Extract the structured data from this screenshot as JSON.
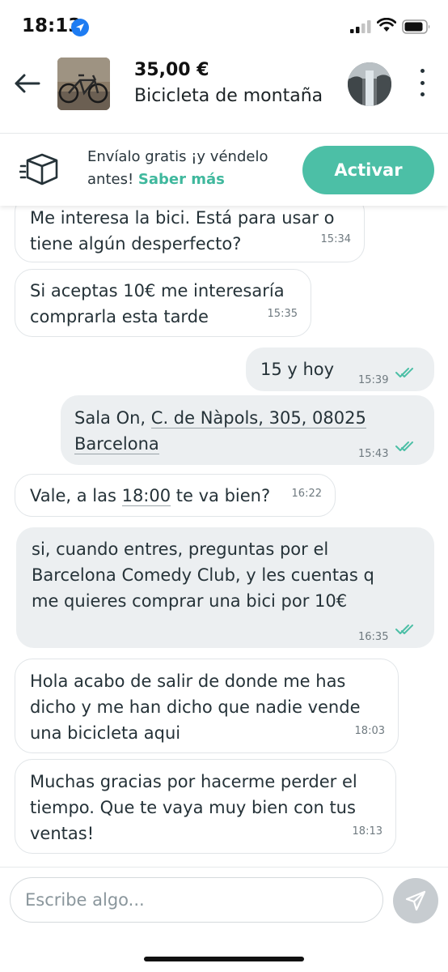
{
  "status_bar": {
    "time": "18:13"
  },
  "header": {
    "price": "35,00 €",
    "title": "Bicicleta de montaña"
  },
  "promo": {
    "text": "Envíalo gratis ¡y véndelo antes!",
    "link": "Saber más",
    "button": "Activar"
  },
  "messages": [
    {
      "dir": "in",
      "lines": [
        "Me interesa la bici. Está para usar o",
        "tiene algún desperfecto?"
      ],
      "time": "15:34"
    },
    {
      "dir": "in",
      "lines": [
        "Si aceptas 10€ me interesaría",
        "comprarla esta tarde"
      ],
      "time": "15:35"
    },
    {
      "dir": "out",
      "lines": [
        "15 y hoy"
      ],
      "time": "15:39"
    },
    {
      "dir": "out",
      "line1_prefix": "Sala On, ",
      "line1_link": "C. de Nàpols, 305, 08025",
      "line2_link": "Barcelona",
      "time": "15:43"
    },
    {
      "dir": "in",
      "prefix": "Vale, a las ",
      "link": "18:00",
      "suffix": " te va bien?",
      "time": "16:22"
    },
    {
      "dir": "out",
      "lines": [
        "si, cuando entres, preguntas por el",
        "Barcelona Comedy Club, y les cuentas q",
        "me quieres comprar una bici por 10€"
      ],
      "time": "16:35"
    },
    {
      "dir": "in",
      "lines": [
        "Hola acabo de salir de donde me has",
        "dicho y me han dicho que nadie vende",
        "una bicicleta aqui"
      ],
      "time": "18:03"
    },
    {
      "dir": "in",
      "lines": [
        "Muchas gracias por hacerme perder el",
        "tiempo. Que te vaya muy bien con tus",
        "ventas!"
      ],
      "time": "18:13"
    }
  ],
  "composer": {
    "placeholder": "Escribe algo..."
  },
  "colors": {
    "accent": "#4cbfa6",
    "link": "#3fb89d",
    "read_ticks": "#4cbfa6"
  },
  "icons": [
    "location-arrow-icon",
    "signal-icon",
    "wifi-icon",
    "battery-icon",
    "back-arrow-icon",
    "more-vertical-icon",
    "shipping-box-icon",
    "send-icon",
    "double-check-icon"
  ]
}
